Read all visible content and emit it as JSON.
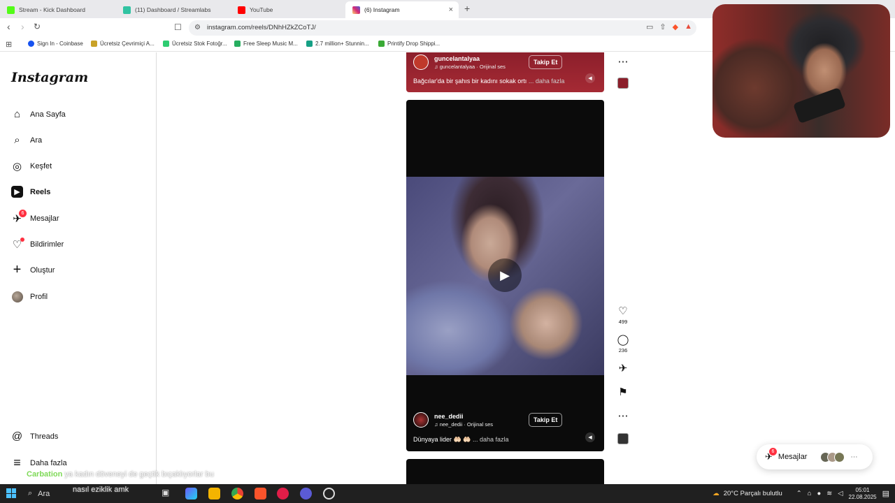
{
  "tabs": [
    {
      "label": "Stream - Kick Dashboard",
      "color": "#53fc18"
    },
    {
      "label": "(11) Dashboard / Streamlabs",
      "color": "#31c3a2"
    },
    {
      "label": "YouTube",
      "color": "#ff0000"
    },
    {
      "label": "(6) Instagram",
      "color": "#d62976",
      "close": "×"
    }
  ],
  "new_tab": "+",
  "address": {
    "url": "instagram.com/reels/DNhHZkZCoTJ/"
  },
  "bookmarks": [
    {
      "label": "Sign In - Coinbase",
      "color": "#1652f0"
    },
    {
      "label": "Ücretsiz Çevrimiçi A...",
      "color": "#c9a227"
    },
    {
      "label": "Ücretsiz Stok Fotoğr...",
      "color": "#2ecc71"
    },
    {
      "label": "Free Sleep Music M...",
      "color": "#27ae60"
    },
    {
      "label": "2.7 million+ Stunnin...",
      "color": "#16a085"
    },
    {
      "label": "Printify Drop Shippi...",
      "color": "#3aaa35"
    }
  ],
  "sidebar": {
    "logo": "Instagram",
    "items": [
      {
        "label": "Ana Sayfa",
        "icon": "home-icon",
        "glyph": "⌂"
      },
      {
        "label": "Ara",
        "icon": "search-icon",
        "glyph": "⌕"
      },
      {
        "label": "Keşfet",
        "icon": "compass-icon",
        "glyph": "◎"
      },
      {
        "label": "Reels",
        "icon": "reels-icon",
        "glyph": "▶"
      },
      {
        "label": "Mesajlar",
        "icon": "messages-icon",
        "glyph": "✈",
        "badge": "6"
      },
      {
        "label": "Bildirimler",
        "icon": "heart-icon",
        "glyph": "♡"
      },
      {
        "label": "Oluştur",
        "icon": "plus-icon",
        "glyph": "+"
      },
      {
        "label": "Profil",
        "icon": "avatar"
      }
    ],
    "bottom": [
      {
        "label": "Threads",
        "icon": "threads-icon",
        "glyph": "@"
      },
      {
        "label": "Daha fazla",
        "icon": "menu-icon",
        "glyph": "≡"
      }
    ]
  },
  "reels": {
    "top": {
      "username": "guncelantalyaa",
      "audio": "guncelantalyaa · Orijinal ses",
      "follow": "Takip Et",
      "caption": "Bağcılar'da bir şahıs bir kadını sokak ortı",
      "more": "... daha fazla"
    },
    "main": {
      "username": "nee_dedii",
      "audio": "nee_dedii · Orijinal ses",
      "follow": "Takip Et",
      "caption": "Dünyaya lider 🤲🏻 🤲🏻",
      "more": "... daha fazla",
      "likes": "499",
      "comments": "236"
    }
  },
  "messages_pill": {
    "label": "Mesajlar",
    "badge": "6"
  },
  "chat": {
    "name": "Carbation",
    "line1": "ya kadın döveneyi de geçtik bıçaklıyorlar bu",
    "line2": "nasıl eziklik amk"
  },
  "taskbar": {
    "search": "Ara",
    "weather": "20°C  Parçalı bulutlu",
    "time": "05:01",
    "date": "22.08.2025"
  }
}
